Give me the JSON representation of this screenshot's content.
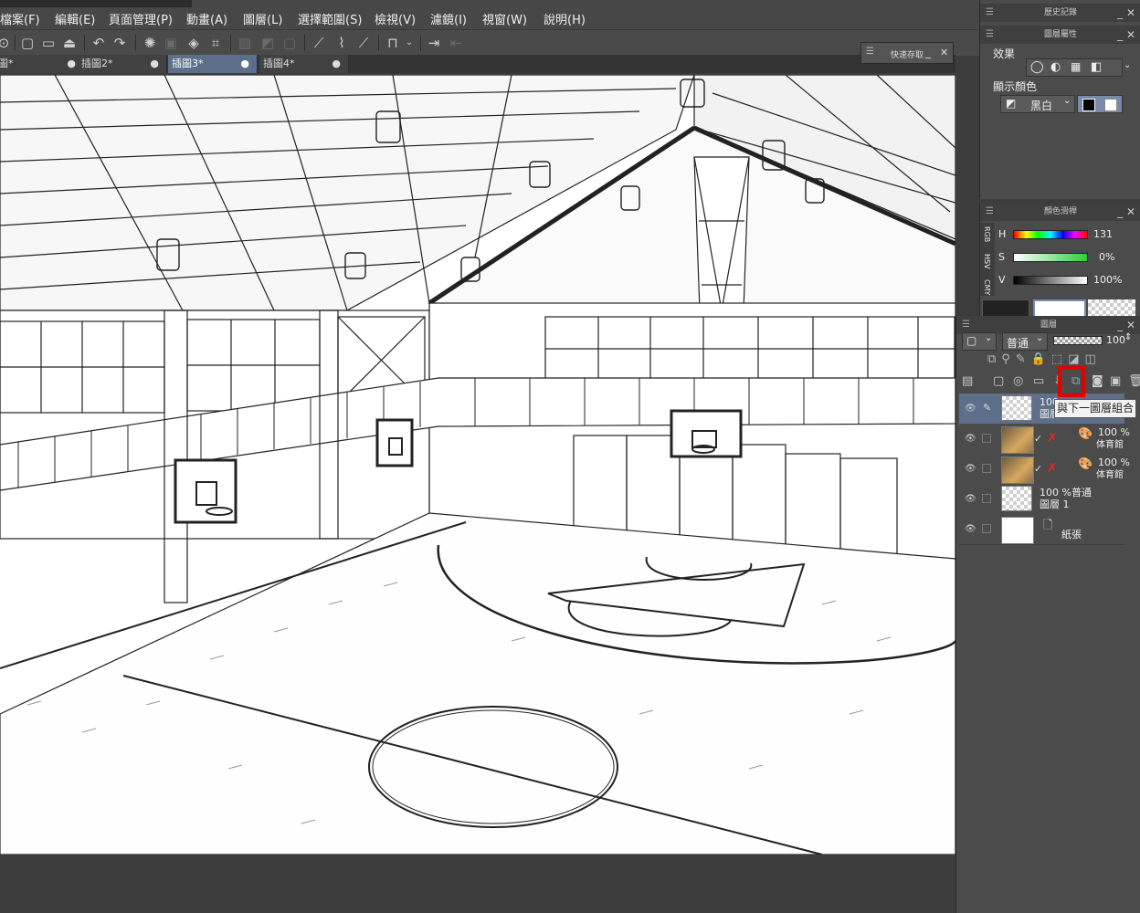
{
  "menu": [
    "檔案(F)",
    "編輯(E)",
    "頁面管理(P)",
    "動畫(A)",
    "圖層(L)",
    "選擇範圍(S)",
    "檢視(V)",
    "濾鏡(I)",
    "視窗(W)",
    "說明(H)"
  ],
  "tabs": [
    {
      "label": "圖*",
      "active": false
    },
    {
      "label": "插圖2*",
      "active": false
    },
    {
      "label": "插圖3*",
      "active": true
    },
    {
      "label": "插圖4*",
      "active": false
    }
  ],
  "quick_access": {
    "title": "快速存取"
  },
  "history_panel": {
    "title": "歷史記錄"
  },
  "layer_property": {
    "title": "圖層屬性",
    "effect_label": "效果",
    "display_color_label": "顯示顏色",
    "color_mode": "黑白"
  },
  "color_panel": {
    "title": "顏色滑桿",
    "mode_tabs": [
      "RGB",
      "HSV",
      "CMY"
    ],
    "h_label": "H",
    "h_value": "131",
    "s_label": "S",
    "s_value": "0%",
    "v_label": "V",
    "v_value": "100%"
  },
  "layer_panel": {
    "title": "圖層",
    "blend_mode": "普通",
    "opacity": "100",
    "tooltip": "與下一圖層組合",
    "layers": [
      {
        "opacity": "100",
        "name": "圖層",
        "type": "raster",
        "selected": true
      },
      {
        "opacity": "100 %",
        "name": "体育館",
        "type": "3d"
      },
      {
        "opacity": "100 %",
        "name": "体育館",
        "type": "3d"
      },
      {
        "opacity": "100 %普通",
        "name": "圖層 1",
        "type": "raster"
      },
      {
        "opacity": "",
        "name": "紙張",
        "type": "paper"
      }
    ]
  },
  "colors": {
    "highlight": "#e00000",
    "active_tab": "#5b6e8a",
    "panel_bg": "#4b4b4b"
  }
}
